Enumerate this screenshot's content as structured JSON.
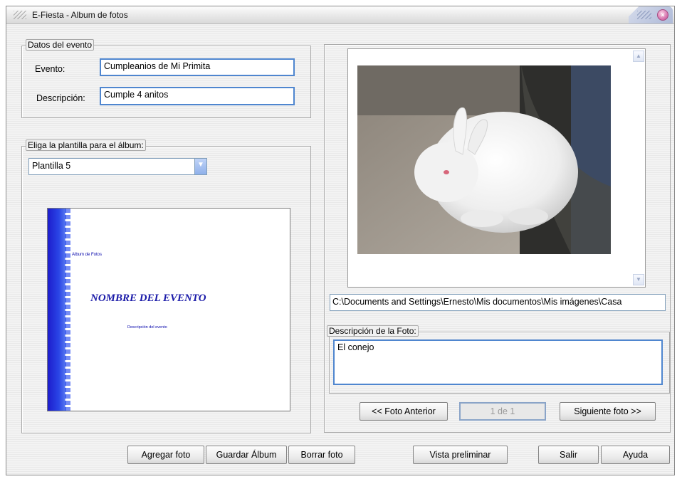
{
  "window": {
    "title": "E-Fiesta - Album de fotos"
  },
  "event_group": {
    "legend": "Datos del evento",
    "event_label": "Evento:",
    "event_value": "Cumpleanios de Mi Primita",
    "desc_label": "Descripción:",
    "desc_value": "Cumple 4 anitos"
  },
  "template_group": {
    "legend": "Eliga la plantilla para el álbum:",
    "selected": "Plantilla 5",
    "preview": {
      "album_text": "Album de Fotos",
      "name_text": "NOMBRE DEL EVENTO",
      "desc_text": "Descripción del evento"
    }
  },
  "photo": {
    "path": "C:\\Documents and Settings\\Ernesto\\Mis documentos\\Mis imágenes\\Casa",
    "desc_legend": "Descripción de la Foto:",
    "desc_value": "El conejo",
    "prev_label": "<< Foto Anterior",
    "counter": "1 de 1",
    "next_label": "Siguiente foto >>"
  },
  "buttons": {
    "add": "Agregar foto",
    "save": "Guardar Álbum",
    "delete": "Borrar foto",
    "preview": "Vista preliminar",
    "exit": "Salir",
    "help": "Ayuda"
  }
}
